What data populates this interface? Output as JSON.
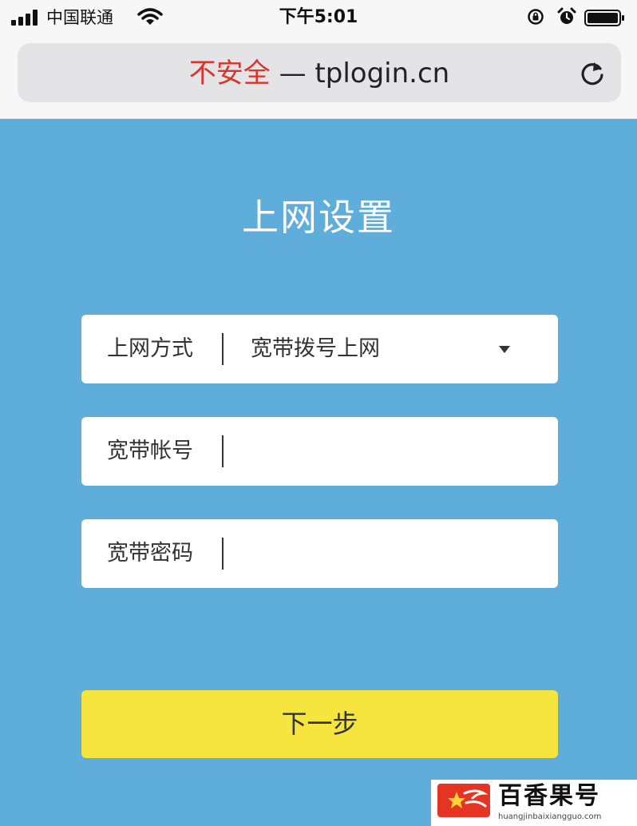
{
  "status_bar": {
    "carrier": "中国联通",
    "time": "下午5:01"
  },
  "browser": {
    "url_insecure": "不安全",
    "url_separator": " — ",
    "url_host": "tplogin.cn"
  },
  "page": {
    "title": "上网设置",
    "fields": [
      {
        "label": "上网方式",
        "value": "宽带拨号上网"
      },
      {
        "label": "宽带帐号",
        "value": ""
      },
      {
        "label": "宽带密码",
        "value": ""
      }
    ],
    "next_button": "下一步"
  },
  "watermark": {
    "name": "百香果号",
    "domain": "huangjinbaixiangguo.com"
  },
  "colors": {
    "page_bg": "#5eaddb",
    "button_bg": "#f7e53f",
    "insecure_text": "#d7342b"
  }
}
